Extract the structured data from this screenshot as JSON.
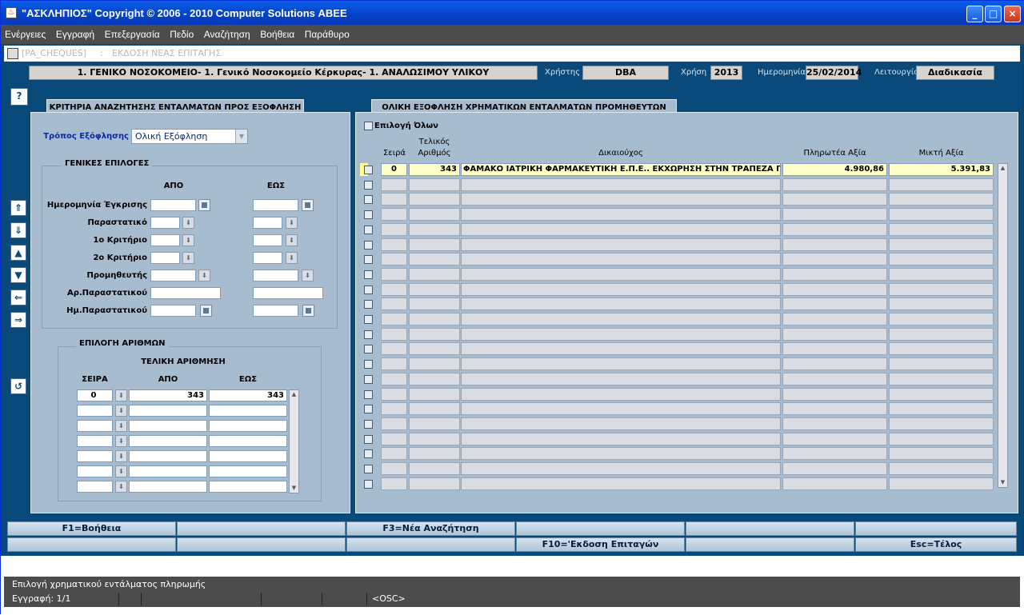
{
  "window": {
    "title": "\"ΑΣΚΛΗΠΙΟΣ\" Copyright © 2006 - 2010 Computer Solutions ΑΒΕΕ",
    "min_label": "_",
    "max_label": "□",
    "close_label": "×"
  },
  "menu": [
    "Ενέργειες",
    "Εγγραφή",
    "Επεξεργασία",
    "Πεδίο",
    "Αναζήτηση",
    "Βοήθεια",
    "Παράθυρο"
  ],
  "doc": {
    "code": "[PA_CHEQUES]",
    "separator": ":",
    "title": "ΕΚΔΟΣΗ ΝΕΑΣ ΕΠΙΤΑΓΗΣ"
  },
  "header": {
    "org": "1. ΓΕΝΙΚΟ ΝΟΣΟΚΟΜΕΙΟ- 1. Γενικό Νοσοκομείο Κέρκυρας- 1. ΑΝΑΛΩΣΙΜΟΥ ΥΛΙΚΟΥ",
    "user_label": "Χρήστης",
    "user": "DBA",
    "year_label": "Χρήση",
    "year": "2013",
    "date_label": "Ημερομηνία",
    "date": "25/02/2014",
    "mode_label": "Λειτουργία",
    "mode": "Διαδικασία"
  },
  "side": {
    "help": "?",
    "first": "⇑",
    "last": "⇓",
    "prev_page": "▲",
    "next_page": "▼",
    "prev": "⇐",
    "next": "⇒",
    "back": "↺"
  },
  "left": {
    "tab_title": "ΚΡΙΤΗΡΙΑ ΑΝΑΖΗΤΗΣΗΣ ΕΝΤΑΛΜΑΤΩΝ ΠΡΟΣ ΕΞΟΦΛΗΣΗ",
    "payment_label": "Τρόπος Εξόφλησης",
    "payment_value": "Ολική Εξόφληση",
    "general": {
      "title": "ΓΕΝΙΚΕΣ ΕΠΙΛΟΓΕΣ",
      "from": "ΑΠΟ",
      "to": "ΕΩΣ",
      "rows": [
        "Ημερομηνία Έγκρισης",
        "Παραστατικό",
        "1ο Κριτήριο",
        "2ο Κριτήριο",
        "Προμηθευτής",
        "Αρ.Παραστατικού",
        "Ημ.Παραστατικού"
      ]
    },
    "numbering": {
      "title": "ΕΠΙΛΟΓΗ ΑΡΙΘΜΩΝ",
      "subtitle": "ΤΕΛΙΚΗ ΑΡΙΘΜΗΣΗ",
      "col_series": "ΣΕΙΡΑ",
      "col_from": "ΑΠΟ",
      "col_to": "ΕΩΣ",
      "first_row": {
        "series": "0",
        "from": "343",
        "to": "343"
      }
    }
  },
  "right": {
    "tab_title": "ΟΛΙΚΗ ΕΞΟΦΛΗΣΗ ΧΡΗΜΑΤΙΚΩΝ ΕΝΤΑΛΜΑΤΩΝ ΠΡΟΜΗΘΕΥΤΩΝ",
    "select_all": "Επιλογή Όλων",
    "columns": {
      "series": "Σειρά",
      "final1": "Τελικός",
      "final2": "Αριθμός",
      "beneficiary": "Δικαιούχος",
      "payable": "Πληρωτέα Αξία",
      "gross": "Μικτή Αξία"
    },
    "first_row": {
      "series": "0",
      "number": "343",
      "beneficiary": "ΦΑΜΑΚΟ ΙΑΤΡΙΚΗ ΦΑΡΜΑΚΕΥΤΙΚΗ Ε.Π.Ε.. ΕΚΧΩΡΗΣΗ ΣΤΗΝ ΤΡΑΠΕΖΑ ΠΕΙΡΑ",
      "payable": "4.980,86",
      "gross": "5.391,83"
    }
  },
  "fkeys": {
    "f1": "F1=Βοήθεια",
    "f3": "F3=Νέα Αναζήτηση",
    "f10": "F10='Εκδοση Επιταγών",
    "esc": "Esc=Τέλος"
  },
  "status": {
    "message": "Επιλογή χρηματικού εντάλματος πληρωμής",
    "record": "Εγγραφή: 1/1",
    "osc": "<OSC>"
  }
}
